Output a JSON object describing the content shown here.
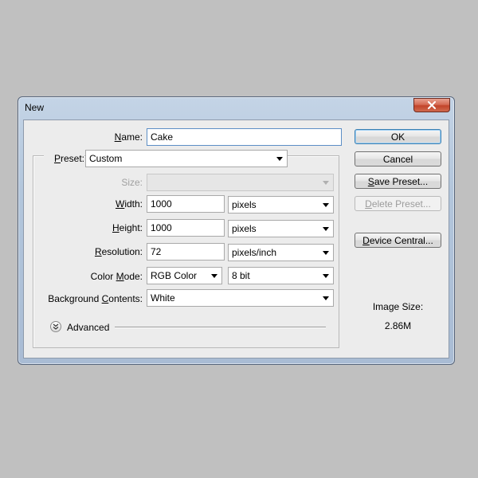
{
  "window": {
    "title": "New"
  },
  "form": {
    "name_label": "Name:",
    "name_value": "Cake",
    "preset_label": "Preset:",
    "preset_value": "Custom",
    "size_label": "Size:",
    "size_value": "",
    "width_label": "Width:",
    "width_value": "1000",
    "width_unit": "pixels",
    "height_label": "Height:",
    "height_value": "1000",
    "height_unit": "pixels",
    "resolution_label": "Resolution:",
    "resolution_value": "72",
    "resolution_unit": "pixels/inch",
    "color_mode_label": "Color Mode:",
    "color_mode_value": "RGB Color",
    "bit_depth_value": "8 bit",
    "background_label": "Background Contents:",
    "background_value": "White",
    "advanced_label": "Advanced"
  },
  "buttons": {
    "ok": "OK",
    "cancel": "Cancel",
    "save_preset": "Save Preset...",
    "delete_preset": "Delete Preset...",
    "device_central": "Device Central..."
  },
  "image_size": {
    "label": "Image Size:",
    "value": "2.86M"
  },
  "icons": {
    "close": "close-icon",
    "dropdown": "chevron-down-icon",
    "advanced": "double-chevron-down-icon"
  },
  "colors": {
    "title_bar": "#b3c6dc",
    "close_button": "#c2442a",
    "default_button_border": "#3c7fb1"
  }
}
